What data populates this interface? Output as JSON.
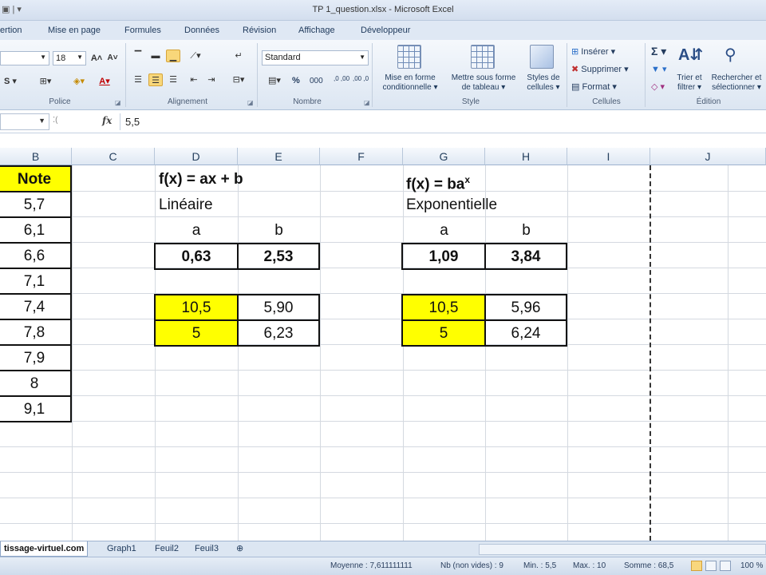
{
  "window": {
    "title": "TP 1_question.xlsx - Microsoft Excel"
  },
  "tabs": [
    "ertion",
    "Mise en page",
    "Formules",
    "Données",
    "Révision",
    "Affichage",
    "Développeur"
  ],
  "ribbon": {
    "font_size": "18",
    "number_format": "Standard",
    "groups": {
      "police": "Police",
      "alignement": "Alignement",
      "nombre": "Nombre",
      "style": "Style",
      "cellules": "Cellules",
      "edition": "Édition"
    },
    "style_buttons": {
      "mise_en_forme_1": "Mise en forme",
      "mise_en_forme_2": "conditionnelle",
      "mettre_sous_forme_1": "Mettre sous forme",
      "mettre_sous_forme_2": "de tableau",
      "styles_1": "Styles de",
      "styles_2": "cellules"
    },
    "cells_buttons": {
      "inserer": "Insérer",
      "supprimer": "Supprimer",
      "format": "Format"
    },
    "edit_buttons": {
      "trier_1": "Trier et",
      "trier_2": "filtrer",
      "rechercher_1": "Rechercher et",
      "rechercher_2": "sélectionner"
    },
    "percent": "%",
    "thousands": "000",
    "dec_inc": ",0 ,00",
    "dec_dec": ",00 ,0"
  },
  "formula_bar": {
    "fx": "fx",
    "value": "5,5"
  },
  "columns": [
    "B",
    "C",
    "D",
    "E",
    "F",
    "G",
    "H",
    "I",
    "J"
  ],
  "sheet": {
    "note_header": "Note",
    "notes": [
      "5,7",
      "6,1",
      "6,6",
      "7,1",
      "7,4",
      "7,8",
      "7,9",
      "8",
      "9,1"
    ],
    "linear": {
      "formula": "f(x) = ax + b",
      "label": "Linéaire",
      "a_label": "a",
      "b_label": "b",
      "a_value": "0,63",
      "b_value": "2,53",
      "rows": [
        [
          "10,5",
          "5,90"
        ],
        [
          "5",
          "6,23"
        ]
      ]
    },
    "exponential": {
      "formula": "f(x) = ba",
      "formula_sup": "x",
      "label": "Exponentielle",
      "a_label": "a",
      "b_label": "b",
      "a_value": "1,09",
      "b_value": "3,84",
      "rows": [
        [
          "10,5",
          "5,96"
        ],
        [
          "5",
          "6,24"
        ]
      ]
    }
  },
  "sheet_tabs": [
    "tissage-virtuel.com",
    "Graph1",
    "Feuil2",
    "Feuil3"
  ],
  "status": {
    "moyenne": "Moyenne : 7,611111111",
    "nb": "Nb (non vides) : 9",
    "min": "Min. : 5,5",
    "max": "Max. : 10",
    "somme": "Somme : 68,5",
    "zoom": "100 %"
  }
}
